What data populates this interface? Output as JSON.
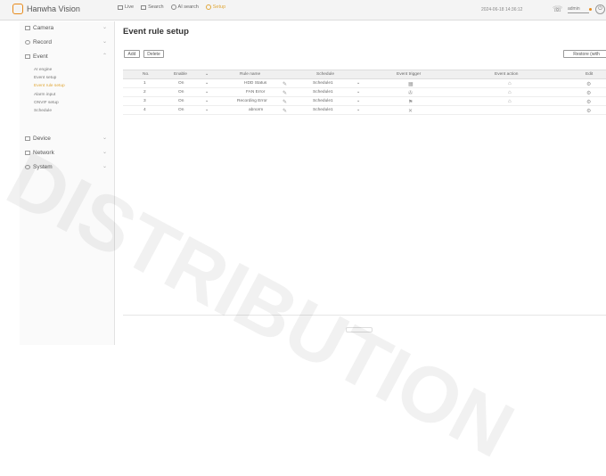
{
  "brand": {
    "name": "Hanwha Vision"
  },
  "topnav": [
    {
      "label": "Live",
      "icon": "monitor-icon"
    },
    {
      "label": "Search",
      "icon": "search-icon"
    },
    {
      "label": "AI search",
      "icon": "ai-search-icon"
    },
    {
      "label": "Setup",
      "icon": "setup-icon"
    }
  ],
  "header": {
    "datetime": "2024-06-18 14:36:12",
    "user": "admin"
  },
  "sidebar": {
    "menus": [
      {
        "label": "Camera",
        "icon": "camera-icon"
      },
      {
        "label": "Record",
        "icon": "record-icon"
      },
      {
        "label": "Event",
        "icon": "event-icon"
      },
      {
        "label": "Device",
        "icon": "device-icon"
      },
      {
        "label": "Network",
        "icon": "network-icon"
      },
      {
        "label": "System",
        "icon": "system-icon"
      }
    ],
    "event_sub": [
      "AI engine",
      "Event setup",
      "Event rule setup",
      "Alarm input",
      "ONVIF setup",
      "Schedule"
    ]
  },
  "page": {
    "title": "Event rule setup",
    "add_label": "Add",
    "delete_label": "Delete",
    "restore_label": "Restore (with notification)"
  },
  "table": {
    "headers": [
      "No.",
      "Enable",
      "Rule name",
      "Schedule",
      "Event trigger",
      "Event action",
      "Edit"
    ],
    "rows": [
      {
        "no": "1",
        "enable": "On",
        "name": "HDD Status",
        "schedule": "Schedule1"
      },
      {
        "no": "2",
        "enable": "On",
        "name": "FAN Error",
        "schedule": "Schedule1"
      },
      {
        "no": "3",
        "enable": "On",
        "name": "Recording Error",
        "schedule": "Schedule1"
      },
      {
        "no": "4",
        "enable": "On",
        "name": "abnorm",
        "schedule": "Schedule1"
      }
    ]
  },
  "watermark": "DISTRIBUTION",
  "colors": {
    "accent": "#e88a1a"
  }
}
